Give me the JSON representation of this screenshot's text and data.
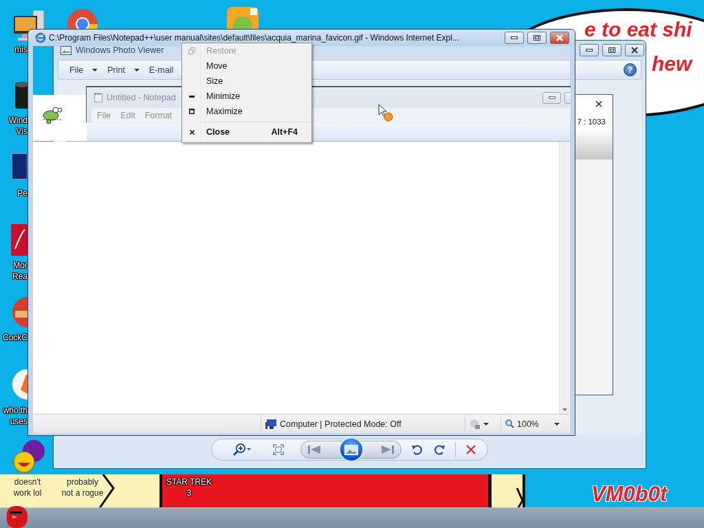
{
  "wallpaper": {
    "bubble_lines": [
      "e to eat shi",
      "hew"
    ],
    "signature": "VM0b0t"
  },
  "desktop_icons": [
    {
      "kind": "computer",
      "label_lines": [
        "mis"
      ]
    },
    {
      "kind": "browser"
    },
    {
      "kind": "game"
    },
    {
      "kind": "speaker",
      "label_lines": [
        "Wind",
        "Vis"
      ]
    },
    {
      "kind": "photoshop",
      "label_lines": [
        "Pe"
      ]
    },
    {
      "kind": "pdf",
      "label_lines": [
        "Mor",
        "Rea"
      ]
    },
    {
      "kind": "cleaner",
      "label_lines": [
        "CockC"
      ]
    },
    {
      "kind": "antivirus",
      "label_lines": [
        "who th",
        "uses"
      ]
    },
    {
      "kind": "messenger",
      "label_lines": [
        "doesn't",
        "work lol"
      ]
    },
    {
      "label_lines": [
        "probably",
        "not a rogue"
      ]
    },
    {
      "label_lines": [
        "STAR TREK",
        "3"
      ]
    }
  ],
  "photo_viewer": {
    "title": "Windows Photo Viewer",
    "menu": [
      {
        "label": "File",
        "dropdown": true
      },
      {
        "label": "Print",
        "dropdown": true
      },
      {
        "label": "E-mail",
        "dropdown": false
      }
    ],
    "help": "?"
  },
  "side_dialog": {
    "close": "×",
    "text": "7 : 1033"
  },
  "browser": {
    "title": "C:\\Program Files\\Notepad++\\user manual\\sites\\default\\files\\acquia_marina_favicon.gif - Windows Internet Expl...",
    "status": "Computer | Protected Mode: Off",
    "zoom": "100%"
  },
  "notepad": {
    "title": "Untitled - Notepad",
    "menu": [
      "File",
      "Edit",
      "Format"
    ]
  },
  "context_menu": {
    "groups": [
      [
        {
          "label": "Restore",
          "kind": "restore",
          "disabled": true,
          "default": false
        },
        {
          "label": "Move",
          "kind": "plain",
          "disabled": false,
          "default": false
        },
        {
          "label": "Size",
          "kind": "plain",
          "disabled": false,
          "default": false
        },
        {
          "label": "Minimize",
          "kind": "minimize",
          "disabled": false,
          "default": false
        },
        {
          "label": "Maximize",
          "kind": "maximize",
          "disabled": false,
          "default": false
        }
      ],
      [
        {
          "label": "Close",
          "kind": "close",
          "shortcut": "Alt+F4",
          "disabled": false,
          "default": true
        }
      ]
    ]
  }
}
